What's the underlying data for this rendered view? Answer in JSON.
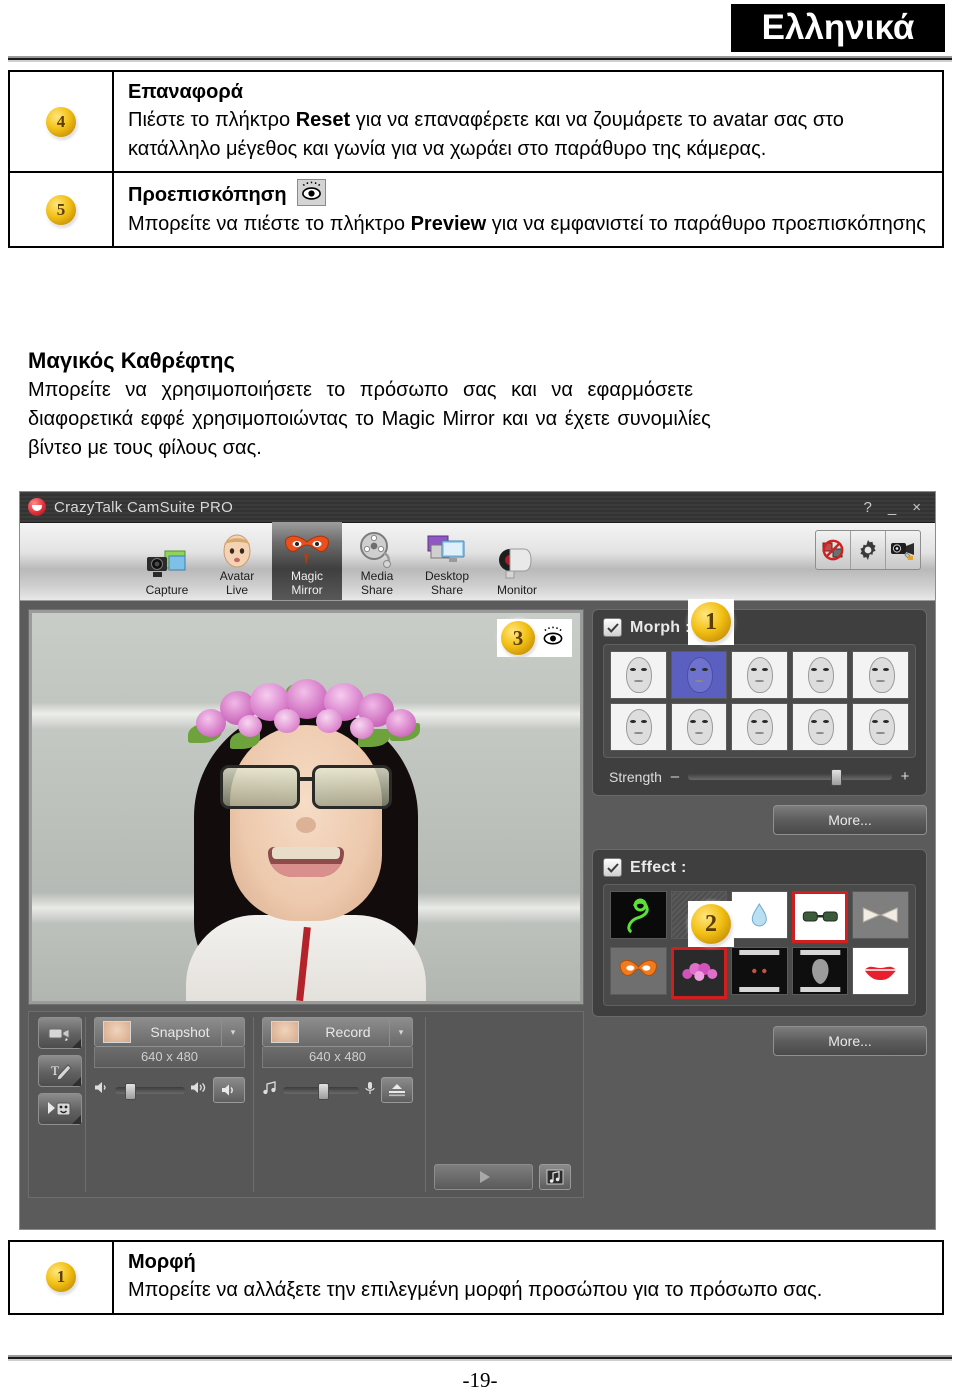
{
  "page": {
    "language_badge": "Ελληνικά",
    "page_number": "-19-"
  },
  "top_table": {
    "rows": [
      {
        "number": "4",
        "title": "Επαναφορά",
        "lines": [
          "Πιέστε το πλήκτρο Reset για να επαναφέρετε και να ζουμάρετε το",
          "avatar σας στο κατάλληλο μέγεθος και γωνία για να χωράει στο",
          "παράθυρο της κάμερας."
        ],
        "bold_terms": [
          "Reset"
        ],
        "icon": null
      },
      {
        "number": "5",
        "title": "Προεπισκόπηση",
        "lines": [
          "Μπορείτε να πιέστε το πλήκτρο Preview για να εμφανιστεί το",
          "παράθυρο προεπισκόπησης"
        ],
        "bold_terms": [
          "Preview"
        ],
        "icon": "eye-preview-icon"
      }
    ]
  },
  "magic_mirror": {
    "title": "Μαγικός Καθρέφτης",
    "paragraph_lines": [
      "Μπορείτε να χρησιμοποιήσετε το πρόσωπο σας και να εφαρμόσετε",
      "διαφορετικά εφφέ χρησιμοποιώντας το Magic Mirror και να έχετε συνομιλίες",
      "βίντεο με τους φίλους σας."
    ]
  },
  "app": {
    "title": "CrazyTalk CamSuite PRO",
    "window_buttons": {
      "help": "?",
      "minimize": "_",
      "close": "×"
    },
    "toolbar": {
      "items": [
        {
          "label_line1": "Capture",
          "label_line2": "",
          "icon": "camera-capture-icon",
          "active": false
        },
        {
          "label_line1": "Avatar",
          "label_line2": "Live",
          "icon": "avatar-face-icon",
          "active": false
        },
        {
          "label_line1": "Magic",
          "label_line2": "Mirror",
          "icon": "magic-mask-icon",
          "active": true
        },
        {
          "label_line1": "Media",
          "label_line2": "Share",
          "icon": "film-reel-icon",
          "active": false
        },
        {
          "label_line1": "Desktop",
          "label_line2": "Share",
          "icon": "desktop-share-icon",
          "active": false
        },
        {
          "label_line1": "Monitor",
          "label_line2": "",
          "icon": "webcam-monitor-icon",
          "active": false
        }
      ],
      "right_buttons": [
        {
          "icon": "no-video-forbidden-icon"
        },
        {
          "icon": "gear-icon"
        },
        {
          "icon": "camera-settings-icon"
        }
      ]
    },
    "video": {
      "badge_number": "3",
      "preview_icon": "eye-preview-icon"
    },
    "controls": {
      "left_buttons": [
        {
          "icon": "video-clip-icon"
        },
        {
          "icon": "text-pen-icon"
        },
        {
          "icon": "emoticon-icon"
        }
      ],
      "snapshot": {
        "label": "Snapshot",
        "resolution": "640 x 480",
        "caret": "▾",
        "thumb_icon": "face-thumb-icon"
      },
      "record": {
        "label": "Record",
        "resolution": "640 x 480",
        "caret": "▾",
        "thumb_icon": "face-thumb-icon"
      },
      "volume_slider": {
        "left_icon": "speaker-low-icon",
        "right_icon": "speaker-high-icon",
        "button_icon": "speaker-mute-icon",
        "value": 22
      },
      "music_slider": {
        "left_icon": "music-note-icon",
        "right_icon": "microphone-icon",
        "button_icon": "mixer-icon",
        "value": 48
      },
      "play_button": {
        "icon": "play-triangle-icon"
      },
      "music_button": {
        "icon": "music-file-icon"
      }
    },
    "morph_panel": {
      "badge_number": "1",
      "checkbox_checked": true,
      "title": "Morph :",
      "thumbnails": [
        {
          "name": "morph-1",
          "selected": false,
          "style": "gray"
        },
        {
          "name": "morph-2",
          "selected": true,
          "style": "blue"
        },
        {
          "name": "morph-3",
          "selected": false,
          "style": "gray"
        },
        {
          "name": "morph-4",
          "selected": false,
          "style": "gray"
        },
        {
          "name": "morph-5",
          "selected": false,
          "style": "gray"
        },
        {
          "name": "morph-6",
          "selected": false,
          "style": "gray"
        },
        {
          "name": "morph-7",
          "selected": false,
          "style": "gray"
        },
        {
          "name": "morph-8",
          "selected": false,
          "style": "gray"
        },
        {
          "name": "morph-9",
          "selected": false,
          "style": "gray"
        },
        {
          "name": "morph-10",
          "selected": false,
          "style": "gray"
        }
      ],
      "strength": {
        "label": "Strength",
        "minus": "–",
        "plus": "+",
        "value": 72
      },
      "more_label": "More..."
    },
    "effect_panel": {
      "badge_number": "2",
      "checkbox_checked": true,
      "title": "Effect :",
      "thumbnails": [
        {
          "name": "effect-neon-swirl",
          "selected": false
        },
        {
          "name": "effect-texture",
          "selected": false
        },
        {
          "name": "effect-water-drop",
          "selected": false
        },
        {
          "name": "effect-sunglasses",
          "selected": true
        },
        {
          "name": "effect-ribbon",
          "selected": false
        },
        {
          "name": "effect-orange-mask",
          "selected": false
        },
        {
          "name": "effect-flower-crown",
          "selected": true
        },
        {
          "name": "effect-dark-eyes",
          "selected": false
        },
        {
          "name": "effect-ghost",
          "selected": false
        },
        {
          "name": "effect-red-lips",
          "selected": false
        }
      ],
      "more_label": "More..."
    }
  },
  "bottom_table": {
    "rows": [
      {
        "number": "1",
        "title": "Μορφή",
        "lines": [
          "Μπορείτε να αλλάξετε την επιλεγμένη μορφή προσώπου για το",
          "πρόσωπο σας."
        ]
      }
    ]
  },
  "colors": {
    "badge_bg": "#000000",
    "coin_gold": "#f2c014",
    "selection_red": "#cf1f1f",
    "window_chrome": "#3b3b3b",
    "panel_bg": "#3f3f3f"
  }
}
